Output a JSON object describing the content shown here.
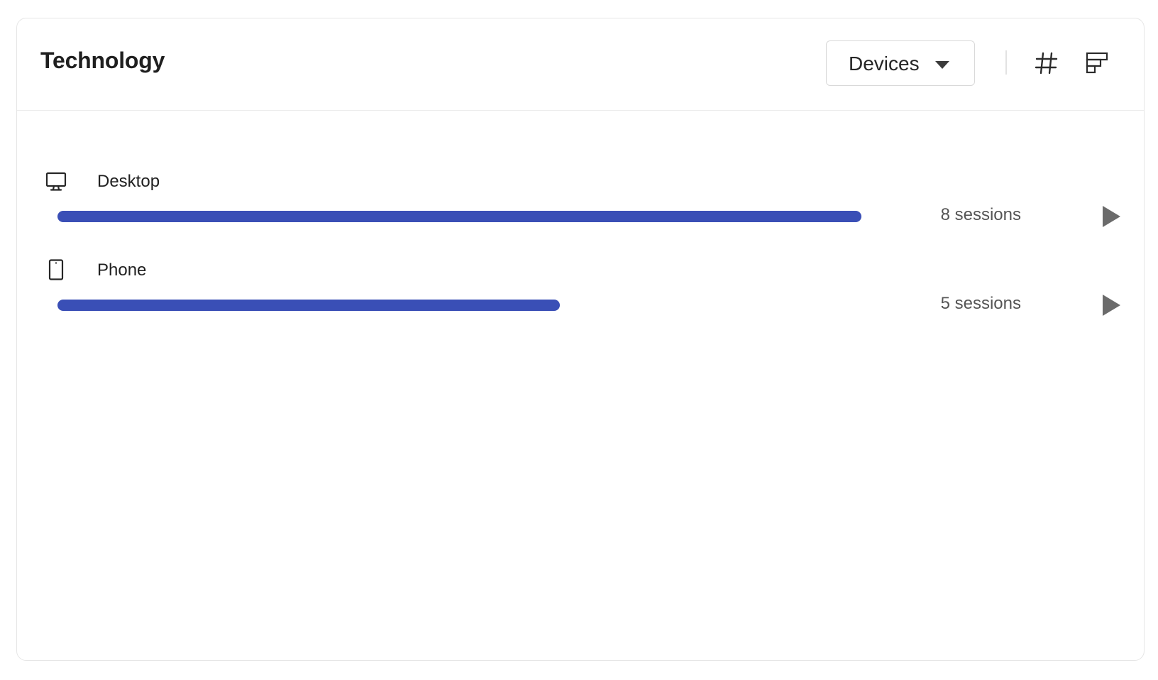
{
  "card": {
    "title": "Technology"
  },
  "toolbar": {
    "dropdown_value": "Devices",
    "hash_icon": "hash-icon",
    "layout_icon": "layout-icon"
  },
  "rows": [
    {
      "label": "Desktop",
      "icon": "desktop-icon",
      "sessions": 8,
      "sessions_text": "8 sessions",
      "share": 1.0
    },
    {
      "label": "Phone",
      "icon": "phone-icon",
      "sessions": 5,
      "sessions_text": "5 sessions",
      "share": 0.625
    }
  ],
  "colors": {
    "bar": "#3a4fb6",
    "play": "#6b6b6b"
  }
}
